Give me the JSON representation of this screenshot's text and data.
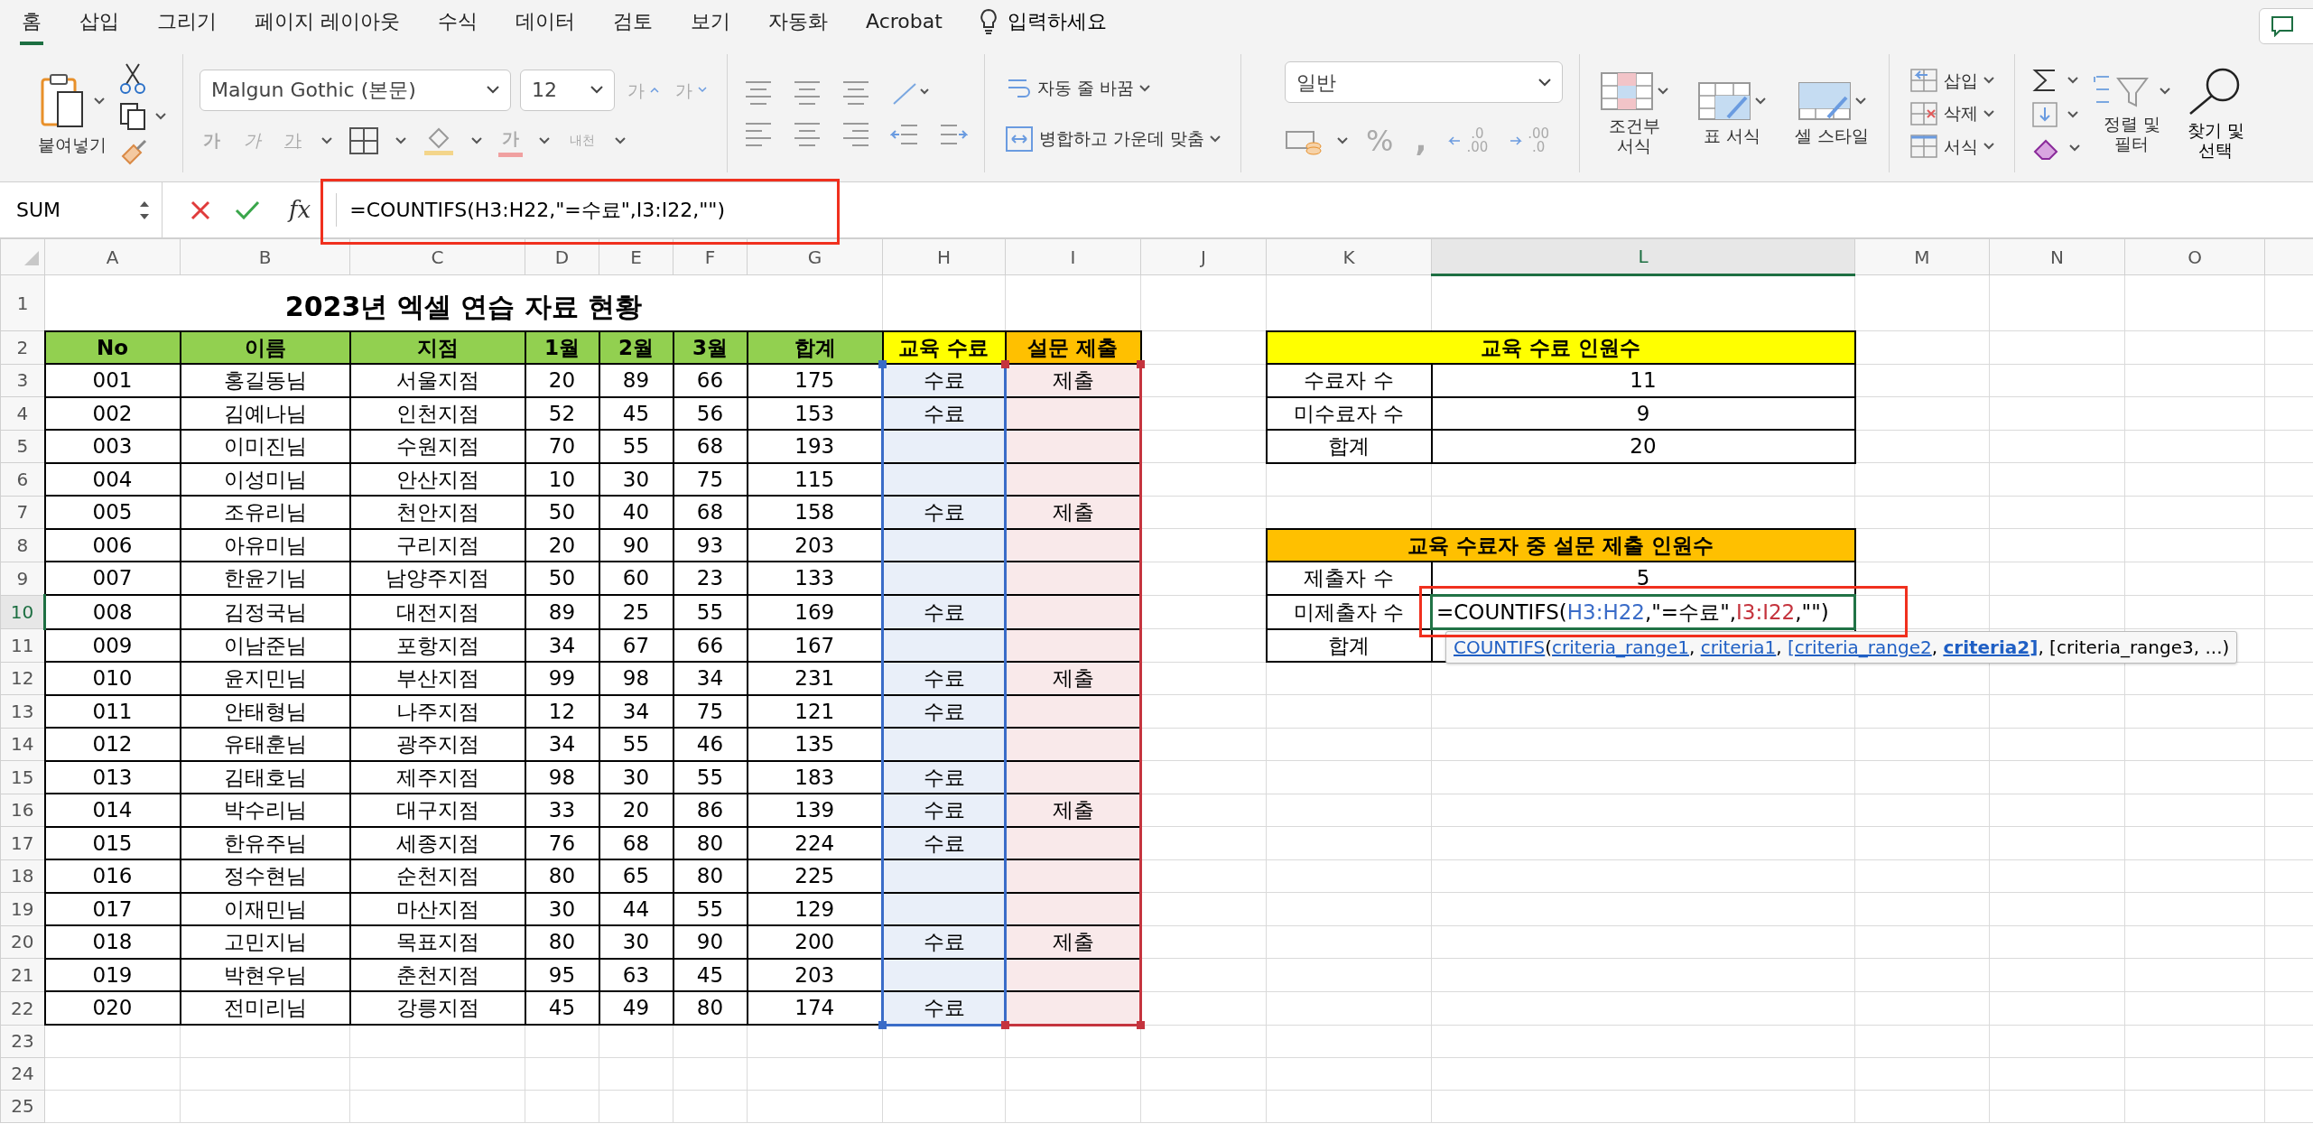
{
  "menu_tabs": [
    {
      "label": "홈",
      "selected": true
    },
    {
      "label": "삽입",
      "selected": false
    },
    {
      "label": "그리기",
      "selected": false
    },
    {
      "label": "페이지 레이아웃",
      "selected": false
    },
    {
      "label": "수식",
      "selected": false
    },
    {
      "label": "데이터",
      "selected": false
    },
    {
      "label": "검토",
      "selected": false
    },
    {
      "label": "보기",
      "selected": false
    },
    {
      "label": "자동화",
      "selected": false
    },
    {
      "label": "Acrobat",
      "selected": false
    }
  ],
  "tell_me": "입력하세요",
  "ribbon": {
    "paste_label": "붙여넣기",
    "font_name": "Malgun Gothic (본문)",
    "font_size": "12",
    "font_grow": "가",
    "font_shrink": "가",
    "style_buttons": [
      {
        "label": "가",
        "kind": "bold"
      },
      {
        "label": "가",
        "kind": "italic"
      },
      {
        "label": "가",
        "kind": "underline"
      }
    ],
    "font_color_label": "가",
    "phonetic_label": "내천",
    "wrap_text": "자동 줄 바꿈",
    "merge_center": "병합하고 가운데 맞춤",
    "number_format": "일반",
    "percent": "%",
    "comma": ",",
    "decimal_buttons": [
      {
        "top": ".0",
        "bottom": ".00"
      },
      {
        "top": ".00",
        "bottom": ".0"
      }
    ],
    "styles": [
      {
        "lines": [
          "조건부",
          "서식"
        ],
        "kind": "conditional"
      },
      {
        "lines": [
          "표 서식"
        ],
        "kind": "table"
      },
      {
        "lines": [
          "셀 스타일"
        ],
        "kind": "cell"
      }
    ],
    "cells": [
      {
        "label": "삽입",
        "kind": "insert"
      },
      {
        "label": "삭제",
        "kind": "delete"
      },
      {
        "label": "서식",
        "kind": "format"
      }
    ],
    "sort_filter": [
      "정렬 및",
      "필터"
    ],
    "find_select": [
      "찾기 및",
      "선택"
    ]
  },
  "formula_bar": {
    "name_box": "SUM",
    "fx": "fx",
    "formula": "=COUNTIFS(H3:H22,\"=수료\",I3:I22,\"\")"
  },
  "sheet": {
    "columns": [
      {
        "label": "A",
        "selected": false
      },
      {
        "label": "B",
        "selected": false
      },
      {
        "label": "C",
        "selected": false
      },
      {
        "label": "D",
        "selected": false
      },
      {
        "label": "E",
        "selected": false
      },
      {
        "label": "F",
        "selected": false
      },
      {
        "label": "G",
        "selected": false
      },
      {
        "label": "H",
        "selected": false
      },
      {
        "label": "I",
        "selected": false
      },
      {
        "label": "J",
        "selected": false
      },
      {
        "label": "K",
        "selected": false
      },
      {
        "label": "L",
        "selected": true
      },
      {
        "label": "M",
        "selected": false
      },
      {
        "label": "N",
        "selected": false
      },
      {
        "label": "O",
        "selected": false
      }
    ],
    "rows": [
      {
        "label": "1",
        "selected": false
      },
      {
        "label": "2",
        "selected": false
      },
      {
        "label": "3",
        "selected": false
      },
      {
        "label": "4",
        "selected": false
      },
      {
        "label": "5",
        "selected": false
      },
      {
        "label": "6",
        "selected": false
      },
      {
        "label": "7",
        "selected": false
      },
      {
        "label": "8",
        "selected": false
      },
      {
        "label": "9",
        "selected": false
      },
      {
        "label": "10",
        "selected": true
      },
      {
        "label": "11",
        "selected": false
      },
      {
        "label": "12",
        "selected": false
      },
      {
        "label": "13",
        "selected": false
      },
      {
        "label": "14",
        "selected": false
      },
      {
        "label": "15",
        "selected": false
      },
      {
        "label": "16",
        "selected": false
      },
      {
        "label": "17",
        "selected": false
      },
      {
        "label": "18",
        "selected": false
      },
      {
        "label": "19",
        "selected": false
      },
      {
        "label": "20",
        "selected": false
      },
      {
        "label": "21",
        "selected": false
      },
      {
        "label": "22",
        "selected": false
      },
      {
        "label": "23",
        "selected": false
      },
      {
        "label": "24",
        "selected": false
      },
      {
        "label": "25",
        "selected": false
      }
    ],
    "title": "2023년 엑셀 연습 자료 현황",
    "table": {
      "columns": [
        {
          "label": "No",
          "color": "#92d050"
        },
        {
          "label": "이름",
          "color": "#92d050"
        },
        {
          "label": "지점",
          "color": "#92d050"
        },
        {
          "label": "1월",
          "color": "#92d050"
        },
        {
          "label": "2월",
          "color": "#92d050"
        },
        {
          "label": "3월",
          "color": "#92d050"
        },
        {
          "label": "합계",
          "color": "#92d050"
        },
        {
          "label": "교육 수료",
          "color": "#ffff00",
          "range": {
            "color": "#3a6cc8"
          }
        },
        {
          "label": "설문 제출",
          "color": "#ffc000",
          "range": {
            "color": "#c5343e"
          }
        }
      ],
      "rows": [
        {
          "no": "001",
          "name": "홍길동님",
          "branch": "서울지점",
          "m1": "20",
          "m2": "89",
          "m3": "66",
          "total": "175",
          "completion": "수료",
          "survey": "제출"
        },
        {
          "no": "002",
          "name": "김예나님",
          "branch": "인천지점",
          "m1": "52",
          "m2": "45",
          "m3": "56",
          "total": "153",
          "completion": "수료"
        },
        {
          "no": "003",
          "name": "이미진님",
          "branch": "수원지점",
          "m1": "70",
          "m2": "55",
          "m3": "68",
          "total": "193"
        },
        {
          "no": "004",
          "name": "이성미님",
          "branch": "안산지점",
          "m1": "10",
          "m2": "30",
          "m3": "75",
          "total": "115"
        },
        {
          "no": "005",
          "name": "조유리님",
          "branch": "천안지점",
          "m1": "50",
          "m2": "40",
          "m3": "68",
          "total": "158",
          "completion": "수료",
          "survey": "제출"
        },
        {
          "no": "006",
          "name": "아유미님",
          "branch": "구리지점",
          "m1": "20",
          "m2": "90",
          "m3": "93",
          "total": "203"
        },
        {
          "no": "007",
          "name": "한윤기님",
          "branch": "남양주지점",
          "m1": "50",
          "m2": "60",
          "m3": "23",
          "total": "133"
        },
        {
          "no": "008",
          "name": "김정국님",
          "branch": "대전지점",
          "m1": "89",
          "m2": "25",
          "m3": "55",
          "total": "169",
          "completion": "수료"
        },
        {
          "no": "009",
          "name": "이남준님",
          "branch": "포항지점",
          "m1": "34",
          "m2": "67",
          "m3": "66",
          "total": "167"
        },
        {
          "no": "010",
          "name": "윤지민님",
          "branch": "부산지점",
          "m1": "99",
          "m2": "98",
          "m3": "34",
          "total": "231",
          "completion": "수료",
          "survey": "제출"
        },
        {
          "no": "011",
          "name": "안태형님",
          "branch": "나주지점",
          "m1": "12",
          "m2": "34",
          "m3": "75",
          "total": "121",
          "completion": "수료"
        },
        {
          "no": "012",
          "name": "유태훈님",
          "branch": "광주지점",
          "m1": "34",
          "m2": "55",
          "m3": "46",
          "total": "135"
        },
        {
          "no": "013",
          "name": "김태호님",
          "branch": "제주지점",
          "m1": "98",
          "m2": "30",
          "m3": "55",
          "total": "183",
          "completion": "수료"
        },
        {
          "no": "014",
          "name": "박수리님",
          "branch": "대구지점",
          "m1": "33",
          "m2": "20",
          "m3": "86",
          "total": "139",
          "completion": "수료",
          "survey": "제출"
        },
        {
          "no": "015",
          "name": "한유주님",
          "branch": "세종지점",
          "m1": "76",
          "m2": "68",
          "m3": "80",
          "total": "224",
          "completion": "수료"
        },
        {
          "no": "016",
          "name": "정수현님",
          "branch": "순천지점",
          "m1": "80",
          "m2": "65",
          "m3": "80",
          "total": "225"
        },
        {
          "no": "017",
          "name": "이재민님",
          "branch": "마산지점",
          "m1": "30",
          "m2": "44",
          "m3": "55",
          "total": "129"
        },
        {
          "no": "018",
          "name": "고민지님",
          "branch": "목표지점",
          "m1": "80",
          "m2": "30",
          "m3": "90",
          "total": "200",
          "completion": "수료",
          "survey": "제출"
        },
        {
          "no": "019",
          "name": "박현우님",
          "branch": "춘천지점",
          "m1": "95",
          "m2": "63",
          "m3": "45",
          "total": "203"
        },
        {
          "no": "020",
          "name": "전미리님",
          "branch": "강릉지점",
          "m1": "45",
          "m2": "49",
          "m3": "80",
          "total": "174",
          "completion": "수료"
        }
      ]
    },
    "summary_tables": [
      {
        "title": "교육 수료 인원수",
        "color": "#ffff00",
        "rows": [
          {
            "label": "수료자 수",
            "value": "11",
            "editing": false
          },
          {
            "label": "미수료자 수",
            "value": "9",
            "editing": false
          },
          {
            "label": "합계",
            "value": "20",
            "editing": false
          }
        ]
      },
      {
        "title": "교육 수료자 중 설문 제출 인원수",
        "color": "#ffc000",
        "rows": [
          {
            "label": "제출자 수",
            "value": "5",
            "editing": false
          },
          {
            "label": "미제출자 수",
            "editing": true,
            "formula": [
              {
                "text": "=COUNTIFS(",
                "color": "#000000"
              },
              {
                "text": "H3:H22",
                "color": "#3a6cc8"
              },
              {
                "text": ",\"=수료\",",
                "color": "#000000"
              },
              {
                "text": "I3:I22",
                "color": "#c5343e"
              },
              {
                "text": ",\"\")",
                "color": "#000000"
              }
            ]
          },
          {
            "label": "합계",
            "editing": false
          }
        ]
      }
    ],
    "function_tip": [
      {
        "text": "COUNTIFS",
        "kind": "link"
      },
      {
        "text": "(",
        "kind": "plain"
      },
      {
        "text": "criteria_range1",
        "kind": "link"
      },
      {
        "text": ", ",
        "kind": "plain"
      },
      {
        "text": "criteria1",
        "kind": "link"
      },
      {
        "text": ", ",
        "kind": "plain"
      },
      {
        "text": "[criteria_range2",
        "kind": "link"
      },
      {
        "text": ", ",
        "kind": "plain"
      },
      {
        "text": "criteria2]",
        "kind": "link-bold"
      },
      {
        "text": ", [criteria_range3, ...)",
        "kind": "plain"
      }
    ]
  }
}
